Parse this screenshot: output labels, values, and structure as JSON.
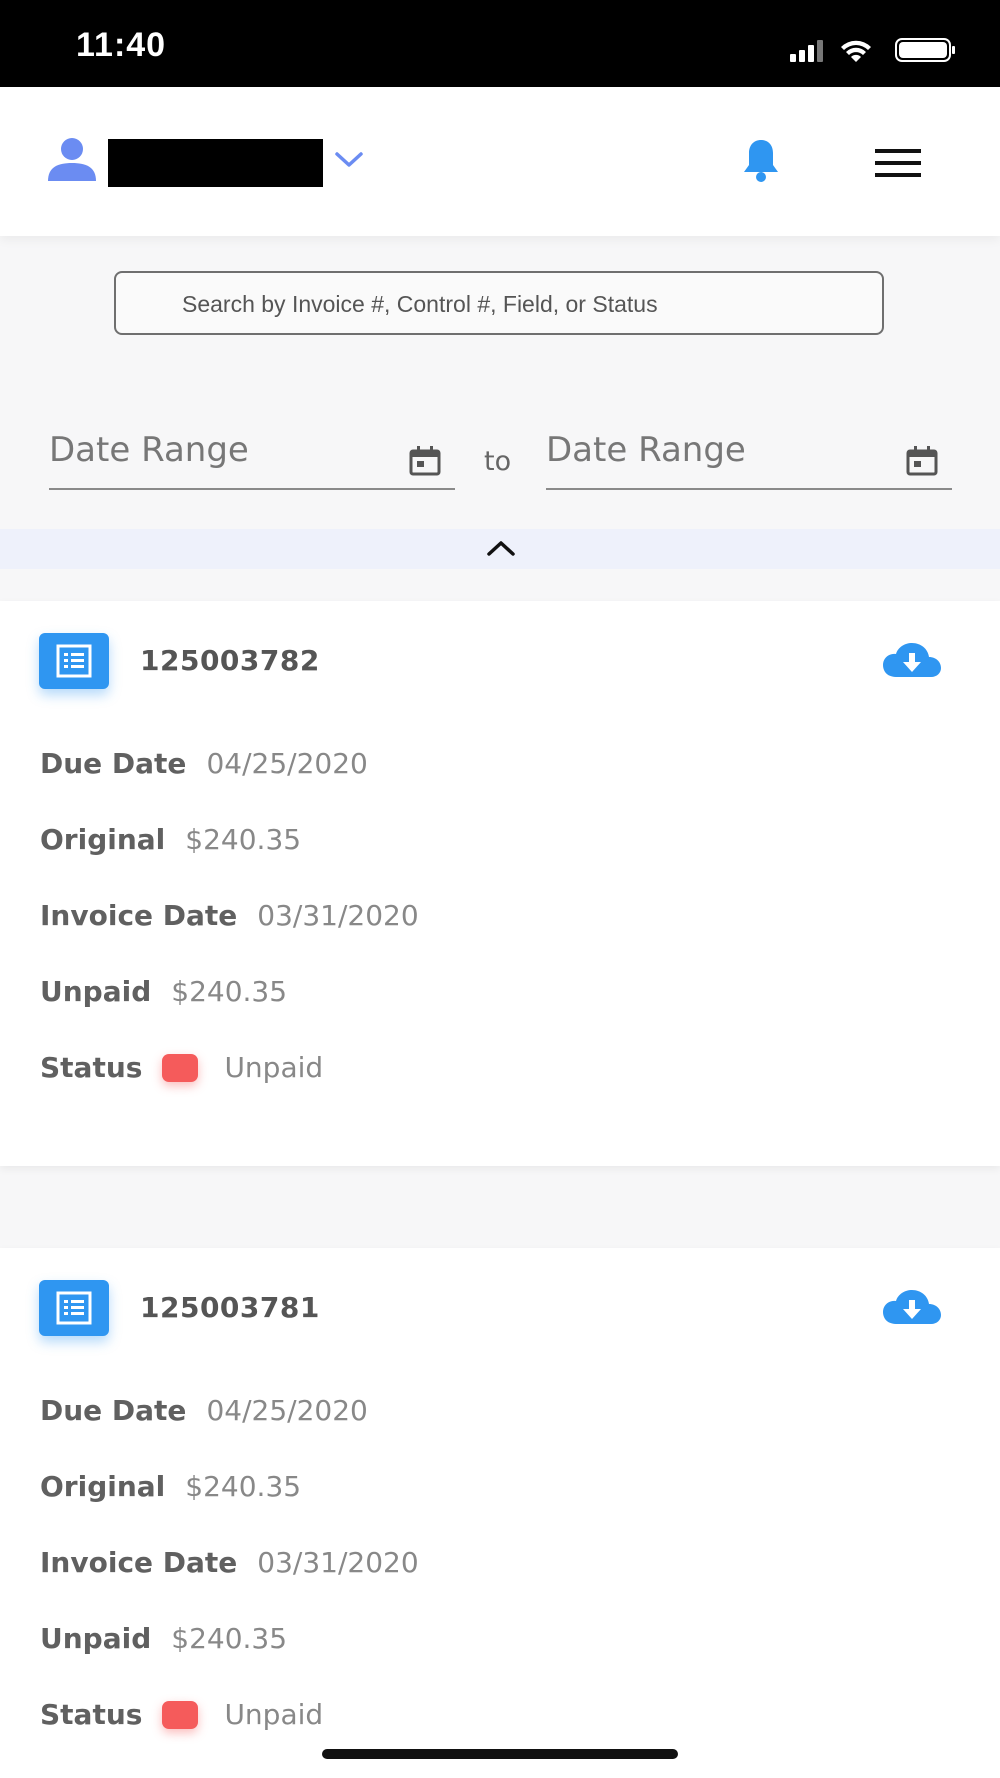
{
  "status_bar": {
    "time": "11:40"
  },
  "header": {
    "user_icon": "user-icon",
    "dropdown_icon": "chevron-down-icon",
    "notification_icon": "bell-icon",
    "menu_icon": "hamburger-menu-icon"
  },
  "search": {
    "placeholder": "Search by Invoice #, Control #, Field, or Status"
  },
  "date_range": {
    "from_placeholder": "Date Range",
    "separator": "to",
    "to_placeholder": "Date Range"
  },
  "collapse_icon": "chevron-up-icon",
  "invoices": [
    {
      "number": "125003782",
      "fields": [
        {
          "label": "Due Date",
          "value": "04/25/2020"
        },
        {
          "label": "Original",
          "value": "$240.35"
        },
        {
          "label": "Invoice Date",
          "value": "03/31/2020"
        },
        {
          "label": "Unpaid",
          "value": "$240.35"
        }
      ],
      "status_label": "Status",
      "status": "Unpaid",
      "status_color": "#f55b5b"
    },
    {
      "number": "125003781",
      "fields": [
        {
          "label": "Due Date",
          "value": "04/25/2020"
        },
        {
          "label": "Original",
          "value": "$240.35"
        },
        {
          "label": "Invoice Date",
          "value": "03/31/2020"
        },
        {
          "label": "Unpaid",
          "value": "$240.35"
        }
      ],
      "status_label": "Status",
      "status": "Unpaid",
      "status_color": "#f55b5b"
    }
  ],
  "colors": {
    "accent": "#2f96f1",
    "chevron": "#6b8cf2"
  }
}
